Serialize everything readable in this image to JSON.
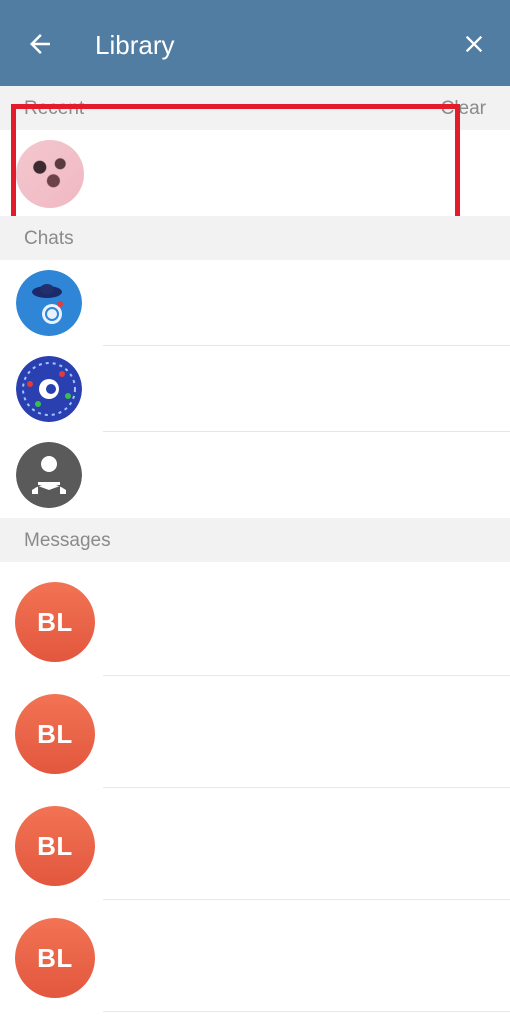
{
  "appbar": {
    "title": "Library",
    "back_icon": "arrow-left-icon",
    "close_icon": "close-icon",
    "color": "#527da3"
  },
  "recent": {
    "label": "Recent",
    "clear_label": "Clear"
  },
  "chats": {
    "label": "Chats",
    "items": [
      {
        "avatar": "ufo-avatar"
      },
      {
        "avatar": "festive-logo-avatar"
      },
      {
        "avatar": "reading-person-avatar"
      }
    ]
  },
  "messages": {
    "label": "Messages",
    "items": [
      {
        "initials": "BL"
      },
      {
        "initials": "BL"
      },
      {
        "initials": "BL"
      },
      {
        "initials": "BL"
      }
    ]
  },
  "highlight_color": "#e31b2b",
  "avatar_color": "#e9604a"
}
